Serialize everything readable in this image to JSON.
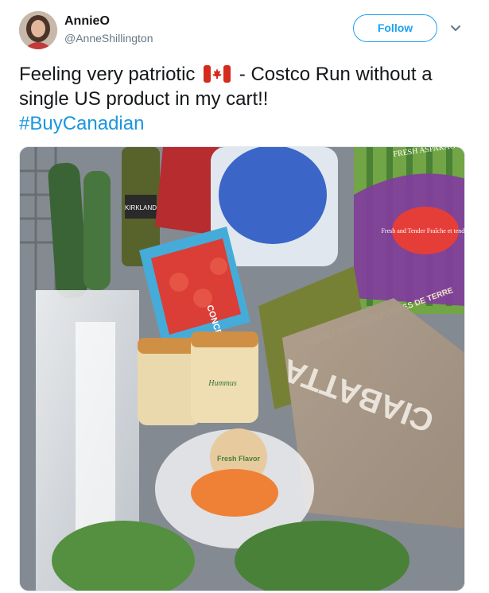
{
  "user": {
    "display_name": "AnnieO",
    "handle": "@AnneShillington"
  },
  "actions": {
    "follow_label": "Follow",
    "caret_icon": "chevron-down-icon"
  },
  "tweet": {
    "text_before_flag": "Feeling very patriotic",
    "flag_icon": "canada-flag-icon",
    "text_after_flag": "- Costco Run without a single US product in my cart!!",
    "hashtag": "#BuyCanadian"
  },
  "media": {
    "labels": {
      "olive_oil": "KIRKLAND",
      "tomatoes": "CONCERTO",
      "hummus": "Hummus",
      "potatoes": "RUSSET POTATOES POMMES DE TERRE",
      "bread": "CIABATTA",
      "asparagus": "FRESH ASPARAGUS ASPERGES FRAICHES",
      "asparagus_tag": "Fresh and Tender Fraîche et tendre",
      "fresh_flavor": "Fresh Flavor"
    }
  },
  "colors": {
    "link": "#1b95e0",
    "follow": "#1da1f2",
    "text": "#14171a",
    "secondary": "#657786"
  }
}
